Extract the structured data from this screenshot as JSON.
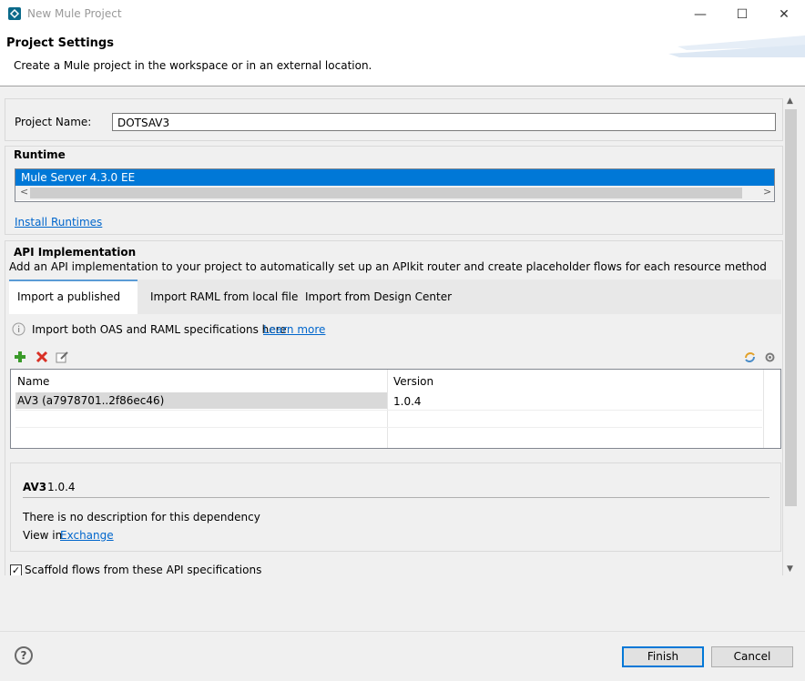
{
  "window": {
    "title": "New Mule Project",
    "controls": {
      "minimize": "—",
      "maximize": "☐",
      "close": "✕"
    }
  },
  "header": {
    "title": "Project Settings",
    "description": "Create a Mule project in the workspace or in an external location."
  },
  "project": {
    "name_label": "Project Name:",
    "name_value": "DOTSAV3"
  },
  "runtime": {
    "heading": "Runtime",
    "selected": "Mule Server 4.3.0 EE",
    "install_link": "Install Runtimes"
  },
  "api": {
    "heading": "API Implementation",
    "description": "Add an API implementation to your project to automatically set up an APIkit router and create placeholder flows for each resource method",
    "tabs": [
      {
        "label": "Import a published API"
      },
      {
        "label": "Import RAML from local file"
      },
      {
        "label": "Import from Design Center"
      }
    ],
    "info_text": "Import both OAS and RAML specifications here",
    "learn_more": "Learn more",
    "table": {
      "columns": [
        "Name",
        "Version"
      ],
      "rows": [
        {
          "name": "AV3 (a7978701..2f86ec46)",
          "version": "1.0.4"
        }
      ]
    },
    "detail": {
      "name": "AV3",
      "version": "1.0.4",
      "description": "There is no description for this dependency",
      "view_in": "View in",
      "exchange_link": "Exchange"
    },
    "scaffold_label": "Scaffold flows from these API specifications",
    "scaffold_checked": "✓"
  },
  "footer": {
    "help": "?",
    "finish": "Finish",
    "cancel": "Cancel"
  },
  "scroll": {
    "up": "▲",
    "down": "▼",
    "left": "<",
    "right": ">"
  },
  "colors": {
    "selection": "#0078d7",
    "link": "#0066cc",
    "add_icon": "#3a9a2a",
    "remove_icon": "#d93025"
  }
}
